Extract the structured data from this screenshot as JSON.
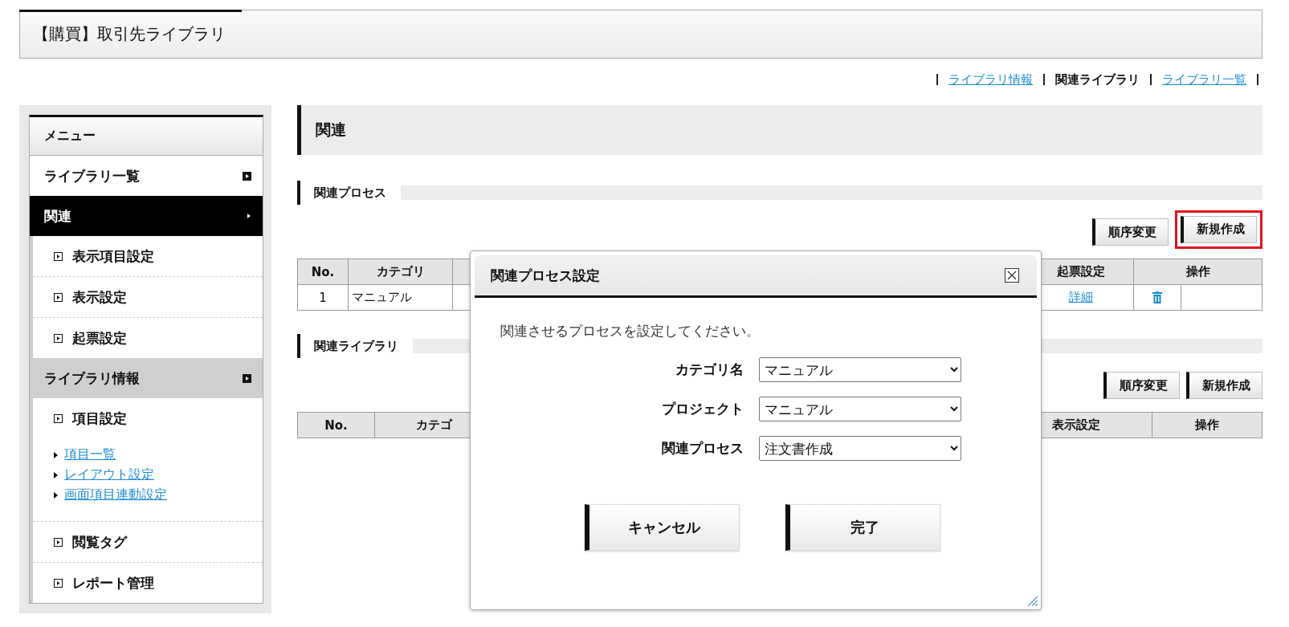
{
  "header": {
    "title": "【購買】取引先ライブラリ"
  },
  "top_links": [
    {
      "label": "ライブラリ情報",
      "selected": false
    },
    {
      "label": "関連ライブラリ",
      "selected": true
    },
    {
      "label": "ライブラリ一覧",
      "selected": false
    }
  ],
  "sidebar": {
    "title": "メニュー",
    "items": [
      {
        "label": "ライブラリ一覧",
        "selected": false,
        "expanded": false
      },
      {
        "label": "関連",
        "selected": true,
        "expanded": true,
        "children": [
          {
            "label": "表示項目設定"
          },
          {
            "label": "表示設定"
          },
          {
            "label": "起票設定"
          }
        ]
      },
      {
        "label": "ライブラリ情報",
        "selected": false,
        "expanded": true,
        "children": [
          {
            "label": "項目設定",
            "links": [
              "項目一覧",
              "レイアウト設定",
              "画面項目連動設定"
            ]
          },
          {
            "label": "閲覧タグ"
          },
          {
            "label": "レポート管理"
          }
        ]
      }
    ]
  },
  "main": {
    "title": "関連",
    "sections": [
      {
        "title": "関連プロセス",
        "buttons": [
          {
            "label": "順序変更",
            "highlighted": false
          },
          {
            "label": "新規作成",
            "highlighted": true
          }
        ],
        "table": {
          "columns": [
            "No.",
            "カテゴリ",
            "起票設定",
            "操作"
          ],
          "rows": [
            [
              {
                "kind": "number",
                "text": "1"
              },
              {
                "kind": "text",
                "text": "マニュアル"
              },
              {
                "kind": "link",
                "text": "詳細"
              },
              {
                "kind": "actions"
              }
            ]
          ]
        }
      },
      {
        "title": "関連ライブラリ",
        "buttons": [
          {
            "label": "順序変更",
            "highlighted": false
          },
          {
            "label": "新規作成",
            "highlighted": false
          }
        ],
        "table": {
          "columns": [
            "No.",
            "カテゴ",
            "表示設定",
            "操作"
          ]
        }
      }
    ]
  },
  "dialog": {
    "title": "関連プロセス設定",
    "message": "関連させるプロセスを設定してください。",
    "fields": [
      {
        "label": "カテゴリ名",
        "value": "マニュアル"
      },
      {
        "label": "プロジェクト",
        "value": "マニュアル"
      },
      {
        "label": "関連プロセス",
        "value": "注文書作成"
      }
    ],
    "buttons": [
      "キャンセル",
      "完了"
    ]
  }
}
